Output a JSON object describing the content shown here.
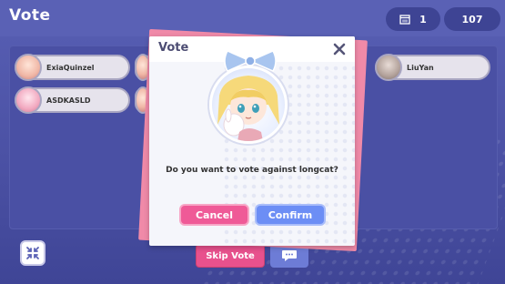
{
  "header": {
    "title": "Vote",
    "day_icon": "calendar-icon",
    "day_value": "1",
    "timer_value": "107"
  },
  "players": [
    {
      "name": "ExiaQuinzel"
    },
    {
      "name": "ASDKASLD"
    },
    {
      "name": ""
    },
    {
      "name": ""
    },
    {
      "name": "LiuYan"
    },
    {
      "name": ""
    }
  ],
  "controls": {
    "skip_label": "Skip Vote",
    "collapse_icon": "collapse-arrows-icon",
    "chat_icon": "chat-bubble-icon"
  },
  "dialog": {
    "title": "Vote",
    "close_icon": "close-icon",
    "question": "Do you want to vote against longcat?",
    "cancel_label": "Cancel",
    "confirm_label": "Confirm"
  },
  "colors": {
    "background": "#4f55a8",
    "cancel": "#ef5a97",
    "confirm": "#6c8ef5",
    "skip": "#e8518d"
  }
}
